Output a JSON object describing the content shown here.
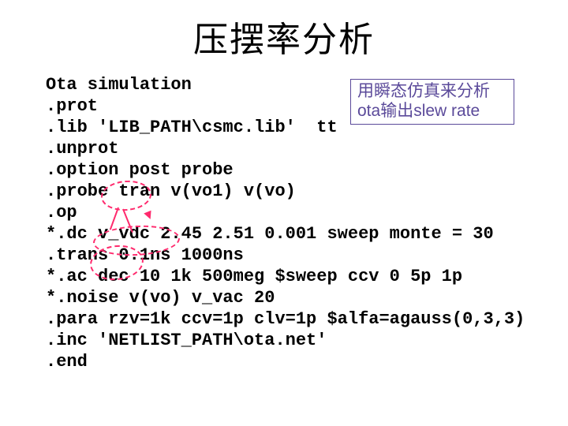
{
  "title": "压摆率分析",
  "code": {
    "l1": "Ota simulation",
    "l2": ".prot",
    "l3": ".lib 'LIB_PATH\\csmc.lib'  tt",
    "l4": ".unprot",
    "l5": ".option post probe",
    "l6": ".probe tran v(vo1) v(vo)",
    "l7": ".op",
    "l8": "*.dc v_vdc 2.45 2.51 0.001 sweep monte = 30",
    "l9": ".trans 0.1ns 1000ns",
    "l10": "*.ac dec 10 1k 500meg $sweep ccv 0 5p 1p",
    "l11": "*.noise v(vo) v_vac 20",
    "l12": ".para rzv=1k ccv=1p clv=1p $alfa=agauss(0,3,3)",
    "l13": ".inc 'NETLIST_PATH\\ota.net'",
    "l14": ".end"
  },
  "annotation": {
    "line1": "用瞬态仿真来分析",
    "line2_pre": "ota",
    "line2_mid": "输出",
    "line2_post": "slew rate"
  }
}
